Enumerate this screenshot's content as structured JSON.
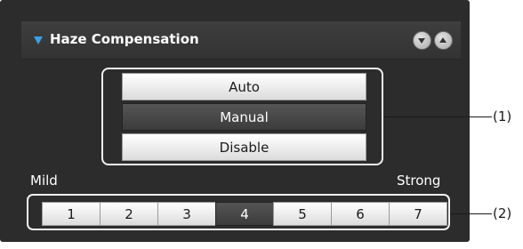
{
  "panel": {
    "title": "Haze Compensation",
    "collapse_icon": "triangle-down-icon",
    "buttons": [
      {
        "name": "scroll-down-button",
        "icon": "chevron-down-icon"
      },
      {
        "name": "scroll-up-button",
        "icon": "chevron-up-icon"
      }
    ]
  },
  "mode": {
    "options": [
      "Auto",
      "Manual",
      "Disable"
    ],
    "selected": "Manual"
  },
  "level": {
    "min_label": "Mild",
    "max_label": "Strong",
    "options": [
      "1",
      "2",
      "3",
      "4",
      "5",
      "6",
      "7"
    ],
    "selected": "4"
  },
  "callouts": {
    "mode": "(1)",
    "level": "(2)"
  },
  "colors": {
    "accent": "#3aa0e6",
    "panel_bg": "#2c2c2c",
    "selected_bg": "#444444"
  }
}
